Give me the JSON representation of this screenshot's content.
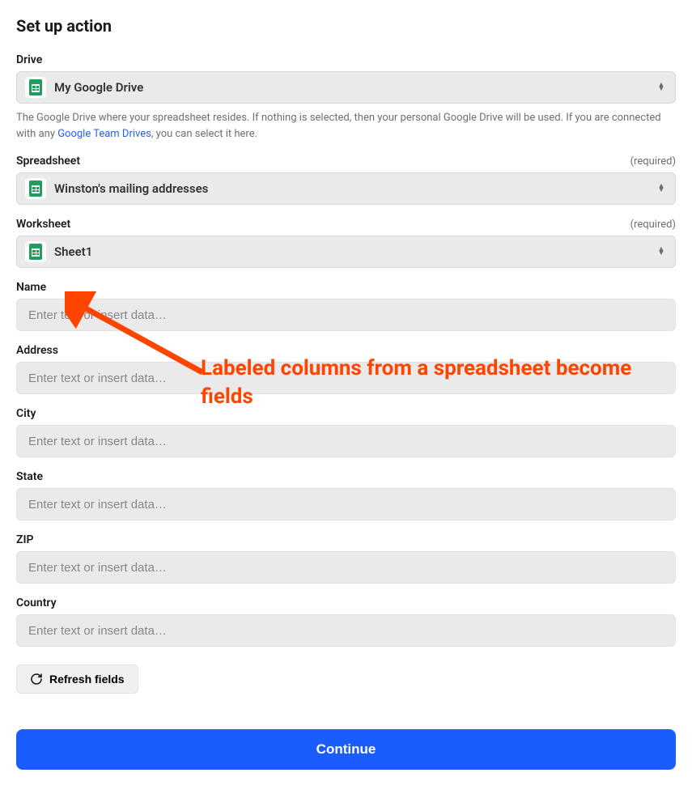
{
  "page_title": "Set up action",
  "drive": {
    "label": "Drive",
    "value": "My Google Drive",
    "help_pre": "The Google Drive where your spreadsheet resides. If nothing is selected, then your personal Google Drive will be used. If you are connected with any ",
    "help_link": "Google Team Drives",
    "help_post": ", you can select it here."
  },
  "spreadsheet": {
    "label": "Spreadsheet",
    "required": "(required)",
    "value": "Winston's mailing addresses"
  },
  "worksheet": {
    "label": "Worksheet",
    "required": "(required)",
    "value": "Sheet1"
  },
  "textFields": [
    {
      "label": "Name",
      "placeholder": "Enter text or insert data…"
    },
    {
      "label": "Address",
      "placeholder": "Enter text or insert data…"
    },
    {
      "label": "City",
      "placeholder": "Enter text or insert data…"
    },
    {
      "label": "State",
      "placeholder": "Enter text or insert data…"
    },
    {
      "label": "ZIP",
      "placeholder": "Enter text or insert data…"
    },
    {
      "label": "Country",
      "placeholder": "Enter text or insert data…"
    }
  ],
  "refresh_label": "Refresh fields",
  "continue_label": "Continue",
  "annotation": "Labeled columns from a spreadsheet become fields"
}
